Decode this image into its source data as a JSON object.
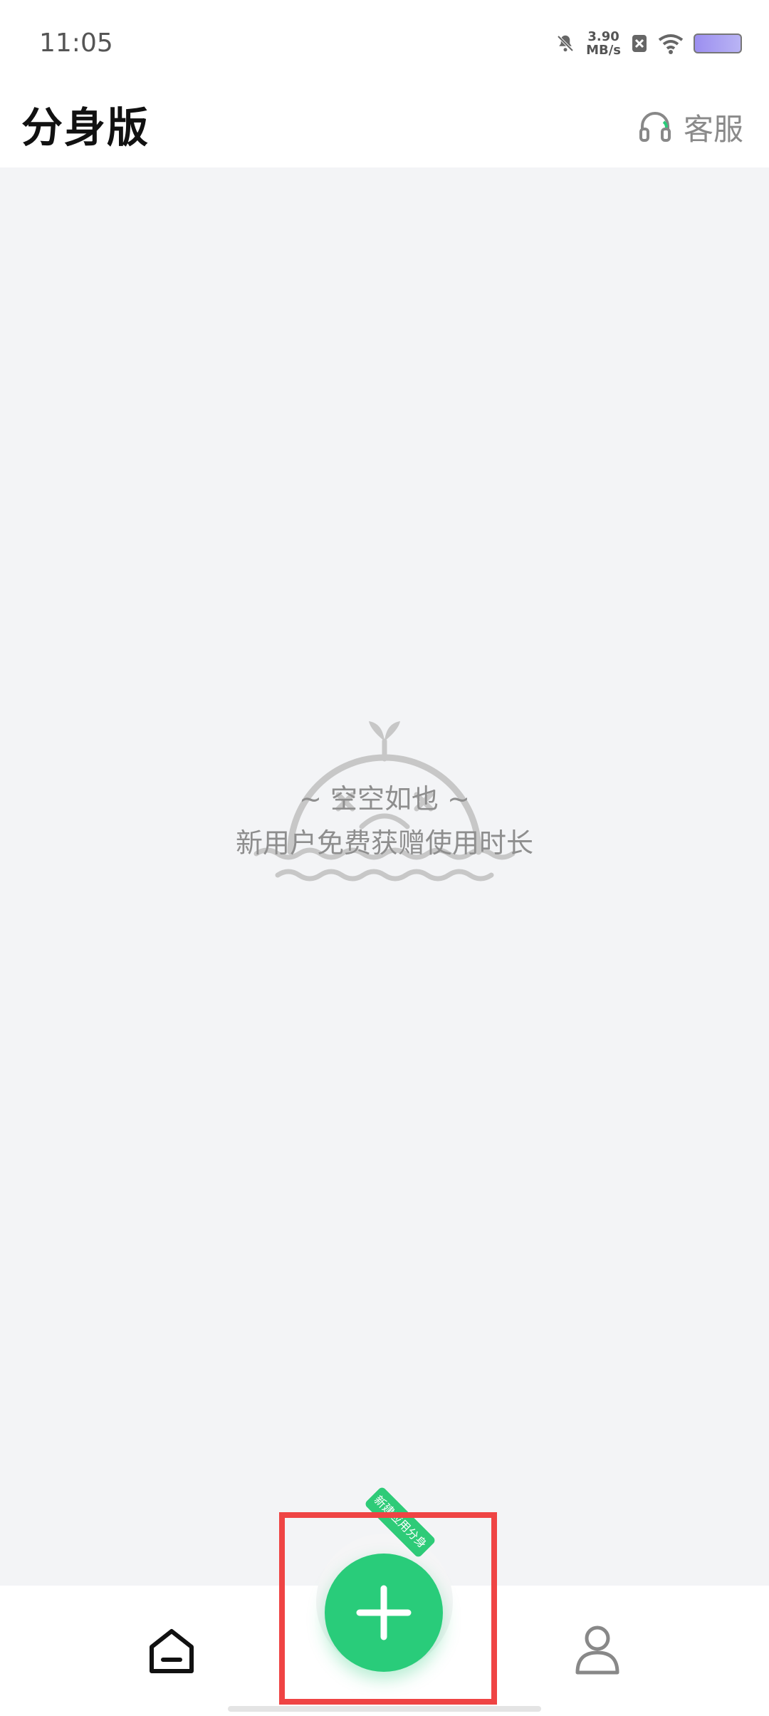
{
  "status_bar": {
    "time": "11:05",
    "speed_value": "3.90",
    "speed_unit": "MB/s"
  },
  "app_bar": {
    "title": "分身版",
    "service_label": "客服"
  },
  "empty_state": {
    "title": "~ 空空如也 ~",
    "subtitle": "新用户免费获赠使用时长"
  },
  "fab": {
    "tag_text": "新建应用分身"
  },
  "colors": {
    "accent": "#29cc7a",
    "highlight": "#ef4444",
    "background": "#f3f4f6"
  },
  "icons": {
    "home": "home-icon",
    "profile": "profile-icon",
    "service": "headset-icon",
    "add": "plus-icon"
  }
}
